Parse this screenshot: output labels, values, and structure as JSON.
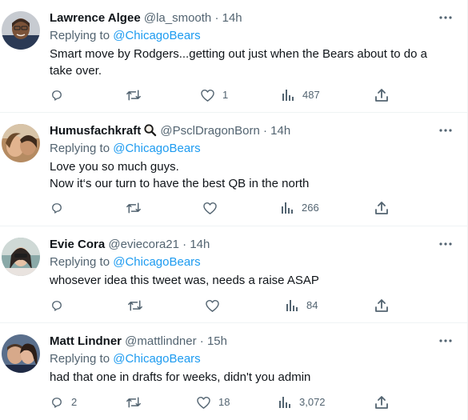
{
  "colors": {
    "text": "#0f1419",
    "secondary": "#536471",
    "accent": "#1d9bf0",
    "divider": "#eff3f4"
  },
  "tweets": [
    {
      "name": "Lawrence Algee",
      "badge": "",
      "handle": "@la_smooth",
      "separator": "·",
      "time": "14h",
      "replying_label": "Replying to",
      "replying_to": "@ChicagoBears",
      "text_lines": [
        "Smart move by Rodgers...getting out just when the Bears about to do a take over."
      ],
      "replies": "",
      "retweets": "",
      "likes": "1",
      "views": "487"
    },
    {
      "name": "Humusfachkraft",
      "badge": "magnifier-icon",
      "handle": "@PsclDragonBorn",
      "separator": "·",
      "time": "14h",
      "replying_label": "Replying to",
      "replying_to": "@ChicagoBears",
      "text_lines": [
        "Love you so much guys.",
        "Now it‘s our turn to have the best QB in the north"
      ],
      "replies": "",
      "retweets": "",
      "likes": "",
      "views": "266"
    },
    {
      "name": "Evie Cora",
      "badge": "",
      "handle": "@eviecora21",
      "separator": "·",
      "time": "14h",
      "replying_label": "Replying to",
      "replying_to": "@ChicagoBears",
      "text_lines": [
        "whosever idea this tweet was, needs a raise ASAP"
      ],
      "replies": "",
      "retweets": "",
      "likes": "",
      "views": "84"
    },
    {
      "name": "Matt Lindner",
      "badge": "",
      "handle": "@mattlindner",
      "separator": "·",
      "time": "15h",
      "replying_label": "Replying to",
      "replying_to": "@ChicagoBears",
      "text_lines": [
        "had that one in drafts for weeks, didn't you admin"
      ],
      "replies": "2",
      "retweets": "",
      "likes": "18",
      "views": "3,072"
    }
  ]
}
